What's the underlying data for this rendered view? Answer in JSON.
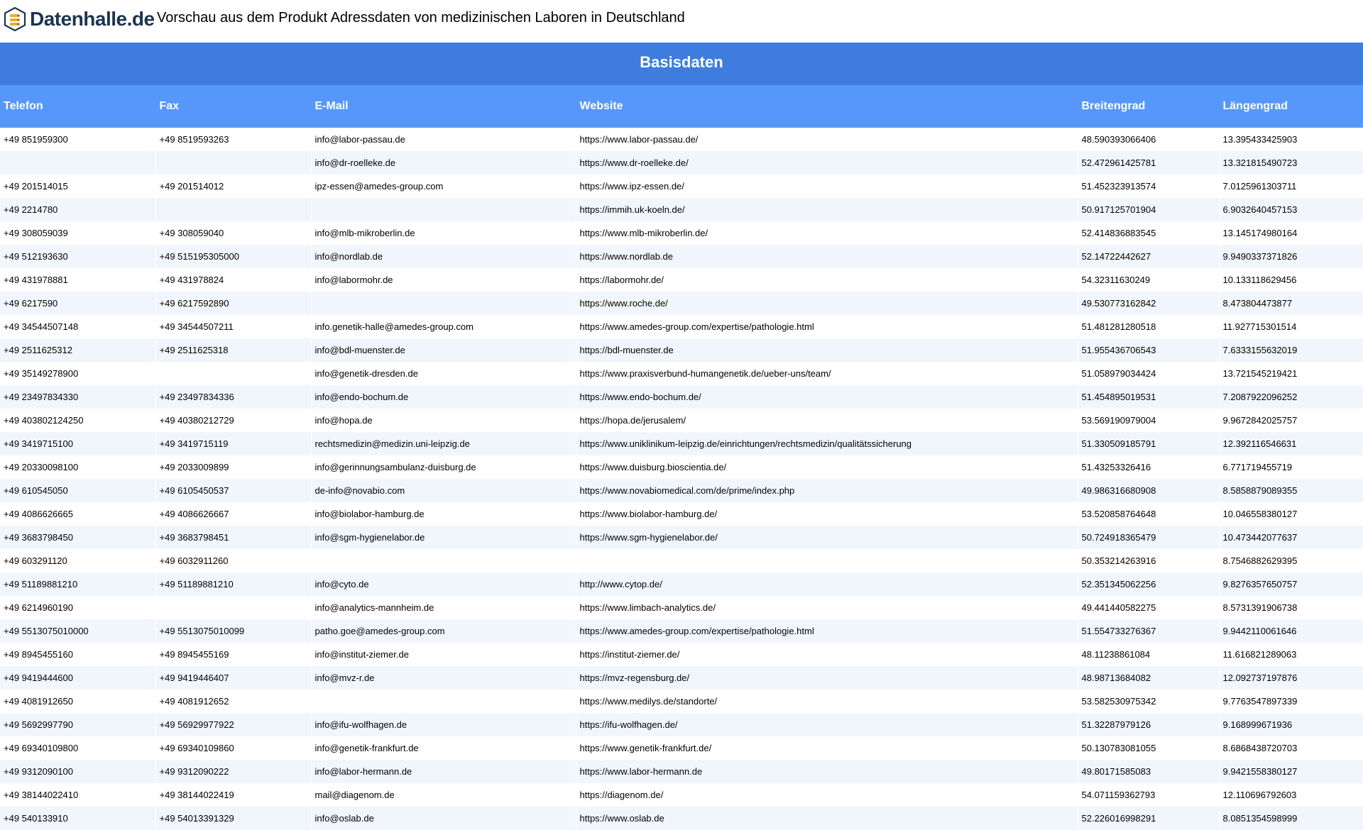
{
  "brand": {
    "name": "Datenhalle.de"
  },
  "page_title": "Vorschau aus dem Produkt Adressdaten von medizinischen Laboren in Deutschland",
  "section_title": "Basisdaten",
  "colors": {
    "section_header": "#3e7ddd",
    "column_header": "#5697fb",
    "row_alt": "#f1f6fd",
    "logo_dark": "#1d3450",
    "logo_gold": "#e6ae2e"
  },
  "table": {
    "columns": [
      "Telefon",
      "Fax",
      "E-Mail",
      "Website",
      "Breitengrad",
      "Längengrad"
    ],
    "rows": [
      [
        "+49 851959300",
        "+49 8519593263",
        "info@labor-passau.de",
        "https://www.labor-passau.de/",
        "48.590393066406",
        "13.395433425903"
      ],
      [
        "",
        "",
        "info@dr-roelleke.de",
        "https://www.dr-roelleke.de/",
        "52.472961425781",
        "13.321815490723"
      ],
      [
        "+49 201514015",
        "+49 201514012",
        "ipz-essen@amedes-group.com",
        "https://www.ipz-essen.de/",
        "51.452323913574",
        "7.0125961303711"
      ],
      [
        "+49 2214780",
        "",
        "",
        "https://immih.uk-koeln.de/",
        "50.917125701904",
        "6.9032640457153"
      ],
      [
        "+49 308059039",
        "+49 308059040",
        "info@mlb-mikroberlin.de",
        "https://www.mlb-mikroberlin.de/",
        "52.414836883545",
        "13.145174980164"
      ],
      [
        "+49 512193630",
        "+49 515195305000",
        "info@nordlab.de",
        "https://www.nordlab.de",
        "52.14722442627",
        "9.9490337371826"
      ],
      [
        "+49 431978881",
        "+49 431978824",
        "info@labormohr.de",
        "https://labormohr.de/",
        "54.32311630249",
        "10.133118629456"
      ],
      [
        "+49 6217590",
        "+49 6217592890",
        "",
        "https://www.roche.de/",
        "49.530773162842",
        "8.473804473877"
      ],
      [
        "+49 34544507148",
        "+49 34544507211",
        "info.genetik-halle@amedes-group.com",
        "https://www.amedes-group.com/expertise/pathologie.html",
        "51.481281280518",
        "11.927715301514"
      ],
      [
        "+49 2511625312",
        "+49 2511625318",
        "info@bdl-muenster.de",
        "https://bdl-muenster.de",
        "51.955436706543",
        "7.6333155632019"
      ],
      [
        "+49 35149278900",
        "",
        "info@genetik-dresden.de",
        "https://www.praxisverbund-humangenetik.de/ueber-uns/team/",
        "51.058979034424",
        "13.721545219421"
      ],
      [
        "+49 23497834330",
        "+49 23497834336",
        "info@endo-bochum.de",
        "https://www.endo-bochum.de/",
        "51.454895019531",
        "7.2087922096252"
      ],
      [
        "+49 403802124250",
        "+49 40380212729",
        "info@hopa.de",
        "https://hopa.de/jerusalem/",
        "53.569190979004",
        "9.9672842025757"
      ],
      [
        "+49 3419715100",
        "+49 3419715119",
        "rechtsmedizin@medizin.uni-leipzig.de",
        "https://www.uniklinikum-leipzig.de/einrichtungen/rechtsmedizin/qualitätssicherung",
        "51.330509185791",
        "12.392116546631"
      ],
      [
        "+49 20330098100",
        "+49 2033009899",
        "info@gerinnungsambulanz-duisburg.de",
        "https://www.duisburg.bioscientia.de/",
        "51.43253326416",
        "6.771719455719"
      ],
      [
        "+49 610545050",
        "+49 6105450537",
        "de-info@novabio.com",
        "https://www.novabiomedical.com/de/prime/index.php",
        "49.986316680908",
        "8.5858879089355"
      ],
      [
        "+49 4086626665",
        "+49 4086626667",
        "info@biolabor-hamburg.de",
        "https://www.biolabor-hamburg.de/",
        "53.520858764648",
        "10.046558380127"
      ],
      [
        "+49 3683798450",
        "+49 3683798451",
        "info@sgm-hygienelabor.de",
        "https://www.sgm-hygienelabor.de/",
        "50.724918365479",
        "10.473442077637"
      ],
      [
        "+49 603291120",
        "+49 6032911260",
        "",
        "",
        "50.353214263916",
        "8.7546882629395"
      ],
      [
        "+49 51189881210",
        "+49 51189881210",
        "info@cyto.de",
        "http://www.cytop.de/",
        "52.351345062256",
        "9.8276357650757"
      ],
      [
        "+49 6214960190",
        "",
        "info@analytics-mannheim.de",
        "https://www.limbach-analytics.de/",
        "49.441440582275",
        "8.5731391906738"
      ],
      [
        "+49 5513075010000",
        "+49 5513075010099",
        "patho.goe@amedes-group.com",
        "https://www.amedes-group.com/expertise/pathologie.html",
        "51.554733276367",
        "9.9442110061646"
      ],
      [
        "+49 8945455160",
        "+49 8945455169",
        "info@institut-ziemer.de",
        "https://institut-ziemer.de/",
        "48.11238861084",
        "11.616821289063"
      ],
      [
        "+49 9419444600",
        "+49 9419446407",
        "info@mvz-r.de",
        "https://mvz-regensburg.de/",
        "48.98713684082",
        "12.092737197876"
      ],
      [
        "+49 4081912650",
        "+49 4081912652",
        "",
        "https://www.medilys.de/standorte/",
        "53.582530975342",
        "9.7763547897339"
      ],
      [
        "+49 5692997790",
        "+49 56929977922",
        "info@ifu-wolfhagen.de",
        "https://ifu-wolfhagen.de/",
        "51.32287979126",
        "9.168999671936"
      ],
      [
        "+49 69340109800",
        "+49 69340109860",
        "info@genetik-frankfurt.de",
        "https://www.genetik-frankfurt.de/",
        "50.130783081055",
        "8.6868438720703"
      ],
      [
        "+49 9312090100",
        "+49 9312090222",
        "info@labor-hermann.de",
        "https://www.labor-hermann.de",
        "49.80171585083",
        "9.9421558380127"
      ],
      [
        "+49 38144022410",
        "+49 38144022419",
        "mail@diagenom.de",
        "https://diagenom.de/",
        "54.071159362793",
        "12.110696792603"
      ],
      [
        "+49 540133910",
        "+49 54013391329",
        "info@oslab.de",
        "https://www.oslab.de",
        "52.226016998291",
        "8.0851354598999"
      ]
    ]
  }
}
